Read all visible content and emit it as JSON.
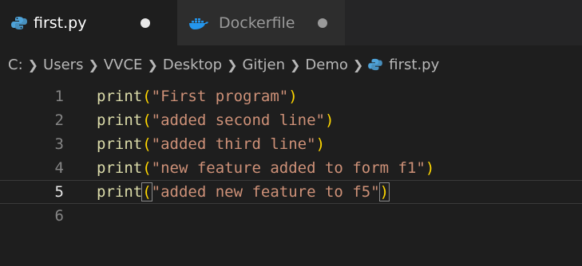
{
  "tabs": [
    {
      "label": "first.py",
      "icon": "python-icon",
      "active": true,
      "modified": true
    },
    {
      "label": "Dockerfile",
      "icon": "docker-icon",
      "active": false,
      "modified": true
    }
  ],
  "breadcrumb": [
    "C:",
    "Users",
    "VVCE",
    "Desktop",
    "Gitjen",
    "Demo",
    "first.py"
  ],
  "editor": {
    "current_line": 5,
    "lines": [
      {
        "number": "1",
        "fn": "print",
        "open": "(",
        "str": "\"First program\"",
        "close": ")"
      },
      {
        "number": "2",
        "fn": "print",
        "open": "(",
        "str": "\"added second line\"",
        "close": ")"
      },
      {
        "number": "3",
        "fn": "print",
        "open": "(",
        "str": "\"added third line\"",
        "close": ")"
      },
      {
        "number": "4",
        "fn": "print",
        "open": "(",
        "str": "\"new feature added to form f1\"",
        "close": ")"
      },
      {
        "number": "5",
        "fn": "print",
        "open": "(",
        "str": "\"added new feature to f5\"",
        "close": ")"
      },
      {
        "number": "6"
      }
    ]
  },
  "colors": {
    "background": "#1e1e1e",
    "function": "#dcdcaa",
    "bracket": "#ffd700",
    "string": "#ce9178",
    "python_icon": "#4fa3d9",
    "docker_icon": "#2496ed"
  }
}
